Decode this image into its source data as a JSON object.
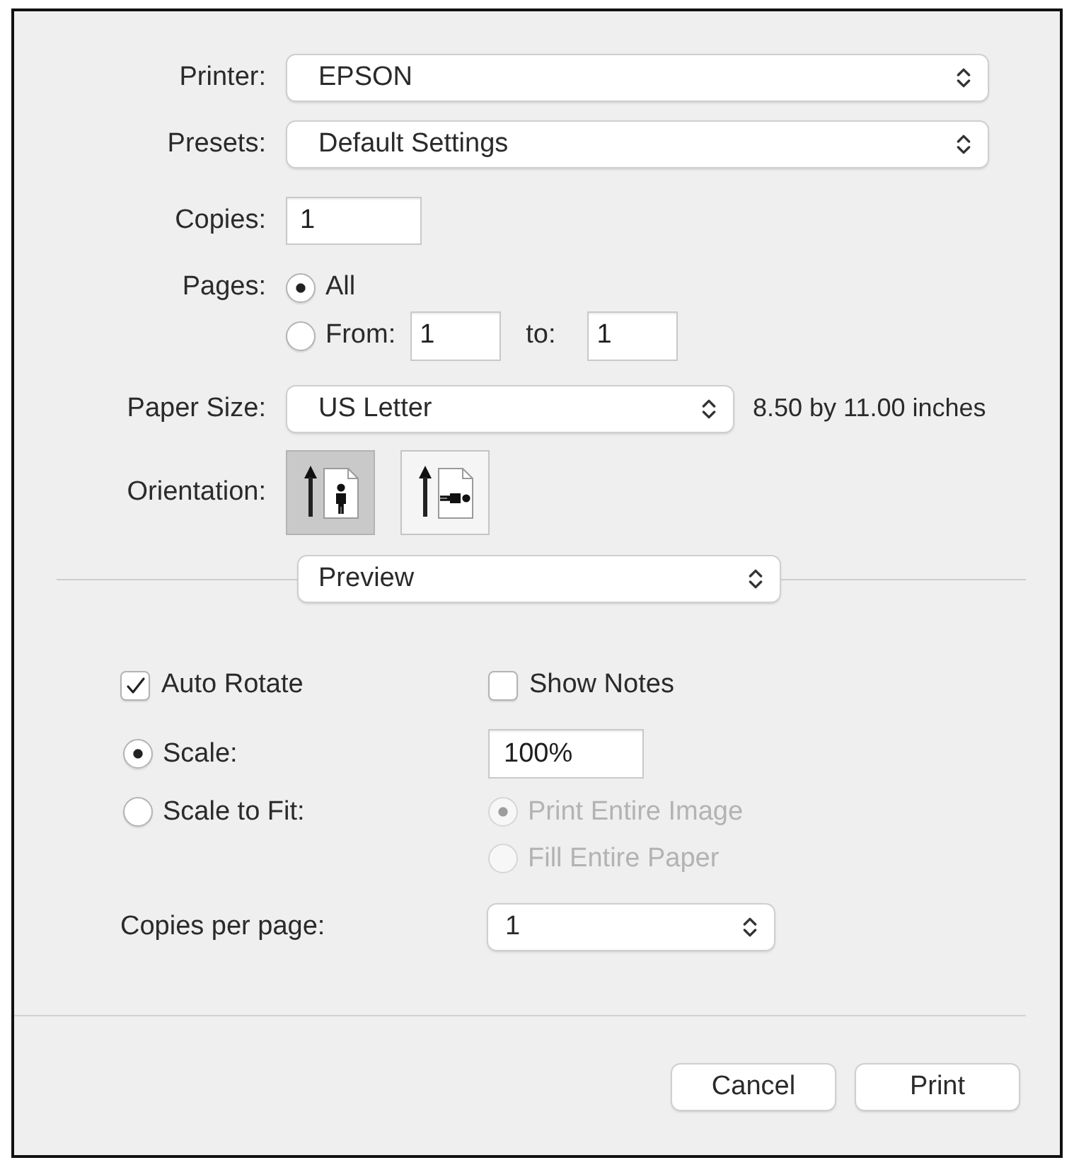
{
  "printer": {
    "label": "Printer:",
    "value": "EPSON"
  },
  "presets": {
    "label": "Presets:",
    "value": "Default Settings"
  },
  "copies": {
    "label": "Copies:",
    "value": "1"
  },
  "pages": {
    "label": "Pages:",
    "options": [
      {
        "kind": "all",
        "label": "All",
        "selected": true
      },
      {
        "kind": "range",
        "label": "From:",
        "from": "1",
        "to_label": "to:",
        "to": "1",
        "selected": false
      }
    ]
  },
  "paper_size": {
    "label": "Paper Size:",
    "value": "US Letter",
    "dimensions": "8.50 by 11.00 inches"
  },
  "orientation": {
    "label": "Orientation:",
    "options": [
      {
        "kind": "portrait",
        "selected": true
      },
      {
        "kind": "landscape",
        "selected": false
      }
    ]
  },
  "panel_menu": {
    "value": "Preview"
  },
  "preview": {
    "checkboxes": [
      {
        "label": "Auto Rotate",
        "checked": true
      },
      {
        "label": "Show Notes",
        "checked": false
      }
    ],
    "scale_options": [
      {
        "kind": "scale",
        "label": "Scale:",
        "selected": true,
        "value": "100%"
      },
      {
        "kind": "fit",
        "label": "Scale to Fit:",
        "selected": false,
        "fit_options": [
          {
            "label": "Print Entire Image",
            "selected": true,
            "disabled": true
          },
          {
            "label": "Fill Entire Paper",
            "selected": false,
            "disabled": true
          }
        ]
      }
    ],
    "copies_per_page": {
      "label": "Copies per page:",
      "value": "1"
    }
  },
  "buttons": [
    {
      "label": "Cancel"
    },
    {
      "label": "Print"
    }
  ]
}
